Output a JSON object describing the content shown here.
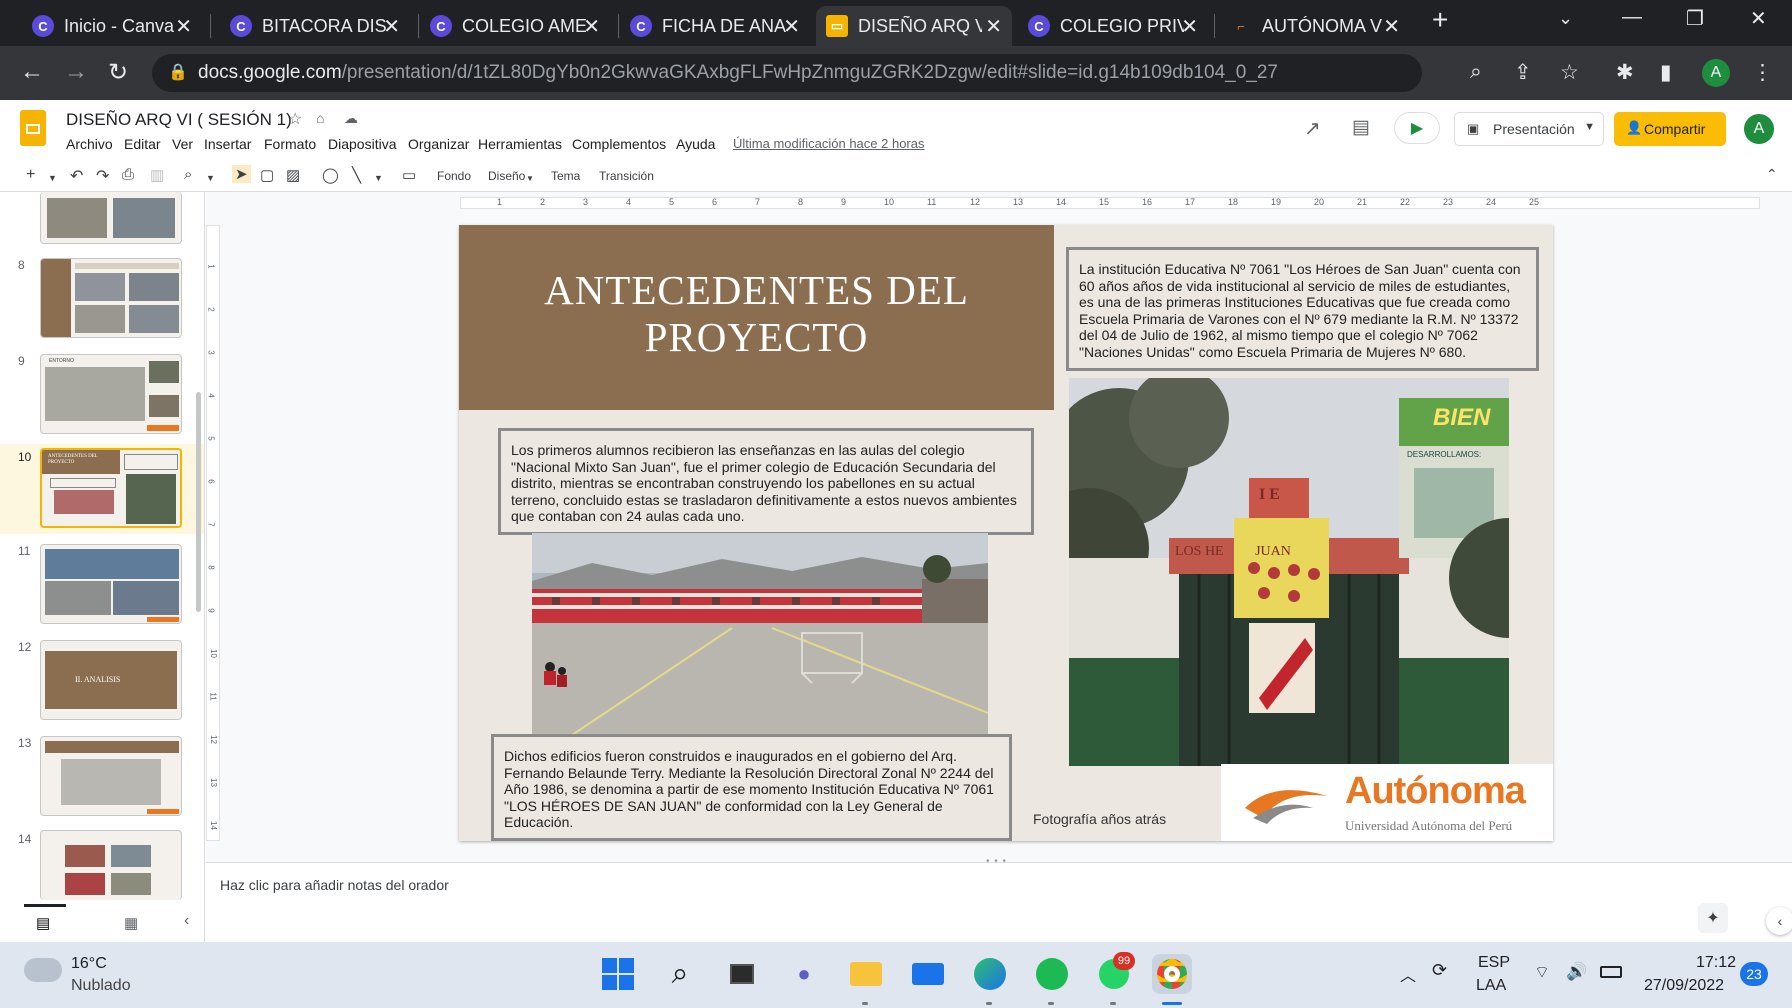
{
  "browser": {
    "tabs": [
      {
        "title": "Inicio - Canva",
        "active": false
      },
      {
        "title": "BITACORA DISE",
        "active": false
      },
      {
        "title": "COLEGIO AMEI",
        "active": false
      },
      {
        "title": "FICHA DE ANA",
        "active": false
      },
      {
        "title": "DISEÑO ARQ V",
        "active": true
      },
      {
        "title": "COLEGIO PRIV",
        "active": false
      },
      {
        "title": "AUTÓNOMA V",
        "active": false
      }
    ],
    "url_domain": "docs.google.com",
    "url_path": "/presentation/d/1tZL80DgYb0n2GkwvaGKAxbgFLFwHpZnmguZGRK2Dzgw/edit#slide=id.g14b109db104_0_27",
    "profile_initial": "A"
  },
  "doc": {
    "title": "DISEÑO ARQ VI ( SESIÓN 1)",
    "menu": [
      "Archivo",
      "Editar",
      "Ver",
      "Insertar",
      "Formato",
      "Diapositiva",
      "Organizar",
      "Herramientas",
      "Complementos",
      "Ayuda"
    ],
    "last_edit": "Última modificación hace 2 horas",
    "present_label": "Presentación",
    "share_label": "Compartir",
    "user_initial": "A"
  },
  "toolbar": {
    "fondo": "Fondo",
    "diseno": "Diseño",
    "tema": "Tema",
    "transicion": "Transición"
  },
  "filmstrip": {
    "slides": [
      {
        "num": "8",
        "label": ""
      },
      {
        "num": "9",
        "label": "ENTORNO"
      },
      {
        "num": "10",
        "label": "ANTECEDENTES DEL PROYECTO",
        "selected": true
      },
      {
        "num": "11",
        "label": ""
      },
      {
        "num": "12",
        "label": "II. ANALISIS"
      },
      {
        "num": "13",
        "label": ""
      },
      {
        "num": "14",
        "label": ""
      }
    ]
  },
  "ruler": {
    "ticks": [
      "1",
      "2",
      "3",
      "4",
      "5",
      "6",
      "7",
      "8",
      "9",
      "10",
      "11",
      "12",
      "13",
      "14",
      "15",
      "16",
      "17",
      "18",
      "19",
      "20",
      "21",
      "22",
      "23",
      "24",
      "25"
    ]
  },
  "slide": {
    "title": "ANTECEDENTES DEL PROYECTO",
    "box1": "La institución Educativa Nº 7061 \"Los Héroes de San Juan\" cuenta con 60 años años de vida institucional al servicio de miles de estudiantes, es una de las primeras Instituciones Educativas que fue creada como Escuela Primaria de Varones con el Nº 679 mediante la R.M. Nº 13372 del 04 de Julio de 1962, al mismo tiempo que el colegio Nº 7062 \"Naciones Unidas\" como Escuela Primaria de Mujeres Nº 680.",
    "box2": "Los primeros alumnos recibieron las enseñanzas en las aulas del colegio \"Nacional Mixto San Juan\", fue el primer colegio de Educación Secundaria del distrito, mientras se encontraban construyendo los pabellones en su actual terreno, concluido estas se trasladaron definitivamente a estos nuevos ambientes que contaban con 24 aulas cada uno.",
    "box3": "Dichos edificios fueron construidos e inaugurados en el gobierno del Arq. Fernando Belaunde Terry. Mediante la Resolución Directoral Zonal Nº 2244 del Año 1986, se denomina a partir de ese momento Institución Educativa Nº 7061 \"LOS HÉROES DE SAN JUAN\" de conformidad con la Ley General de Educación.",
    "caption": "Fotografía años atrás",
    "logo_name": "Autónoma",
    "logo_sub": "Universidad Autónoma del Perú",
    "gate_letters": "I E",
    "gate_sign": "LOS HE         JUAN",
    "banner_text": "BIEN",
    "banner_sub": "DESARROLLAMOS:"
  },
  "notes": {
    "placeholder": "Haz clic para añadir notas del orador"
  },
  "taskbar": {
    "weather_temp": "16°C",
    "weather_desc": "Nublado",
    "lang1": "ESP",
    "lang2": "LAA",
    "time": "17:12",
    "date": "27/09/2022",
    "notif_count": "23",
    "whatsapp_badge": "99"
  }
}
